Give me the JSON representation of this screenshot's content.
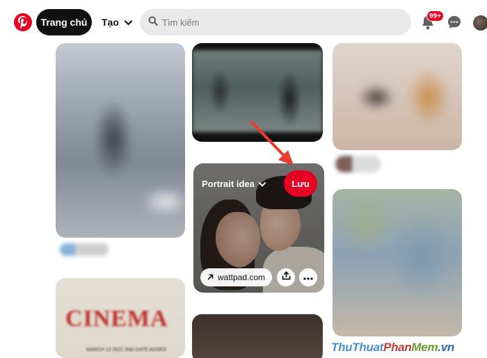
{
  "header": {
    "home_label": "Trang chủ",
    "create_label": "Tạo",
    "search_placeholder": "Tìm kiếm",
    "notification_count": "99+"
  },
  "feed": {
    "focused_pin": {
      "board_name": "Portrait idea",
      "save_label": "Lưu",
      "source_domain": "wattpad.com"
    },
    "blurred_pin_text": {
      "cinema_title": "CINEMA",
      "cinema_sub": "MARCH 13 2022   2ND DATE ADDED"
    }
  },
  "watermark": {
    "part1": "Thu",
    "part2": "Thuat",
    "part3": "Phan",
    "part4": "Mem",
    "part5": ".vn"
  },
  "colors": {
    "brand_red": "#e60023",
    "home_bg": "#111111",
    "search_bg": "#e9e9e9"
  },
  "icons": [
    "pinterest-logo-icon",
    "chevron-down-icon",
    "search-icon",
    "bell-icon",
    "chat-bubble-icon",
    "external-link-arrow-icon",
    "share-icon",
    "more-dots-icon"
  ]
}
